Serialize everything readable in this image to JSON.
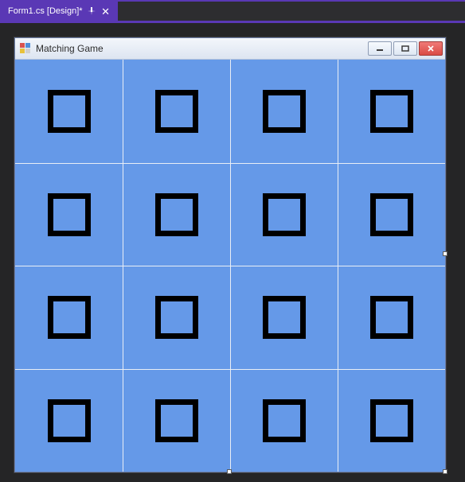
{
  "ide": {
    "tab_label": "Form1.cs [Design]*"
  },
  "window": {
    "title": "Matching Game"
  },
  "grid": {
    "rows": 4,
    "cols": 4
  }
}
